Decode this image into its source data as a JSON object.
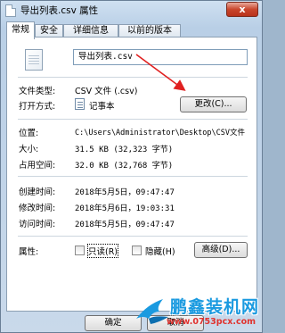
{
  "window": {
    "title": "导出列表.csv 属性",
    "close_label": "x"
  },
  "tabs": [
    {
      "label": "常规",
      "active": true
    },
    {
      "label": "安全",
      "active": false
    },
    {
      "label": "详细信息",
      "active": false
    },
    {
      "label": "以前的版本",
      "active": false
    }
  ],
  "general": {
    "file_name": "导出列表.csv",
    "file_type_label": "文件类型:",
    "file_type_value": "CSV 文件 (.csv)",
    "opens_with_label": "打开方式:",
    "opens_with_value": "记事本",
    "change_button": "更改(C)...",
    "location_label": "位置:",
    "location_value": "C:\\Users\\Administrator\\Desktop\\CSV文件",
    "size_label": "大小:",
    "size_value": "31.5 KB (32,323 字节)",
    "size_on_disk_label": "占用空间:",
    "size_on_disk_value": "32.0 KB (32,768 字节)",
    "created_label": "创建时间:",
    "created_value": "2018年5月5日，09:47:47",
    "modified_label": "修改时间:",
    "modified_value": "2018年5月6日，19:03:31",
    "accessed_label": "访问时间:",
    "accessed_value": "2018年5月5日，09:47:47",
    "attributes_label": "属性:",
    "readonly_label": "只读(R)",
    "hidden_label": "隐藏(H)",
    "advanced_button": "高级(D)..."
  },
  "footer": {
    "ok_button": "确定",
    "cancel_button": "取消"
  },
  "watermark": {
    "text": "鹏鑫装机网",
    "url": "www.0753pcx.com",
    "color": "#1a9ae0"
  },
  "annotation": {
    "arrow_color": "#e02020"
  }
}
